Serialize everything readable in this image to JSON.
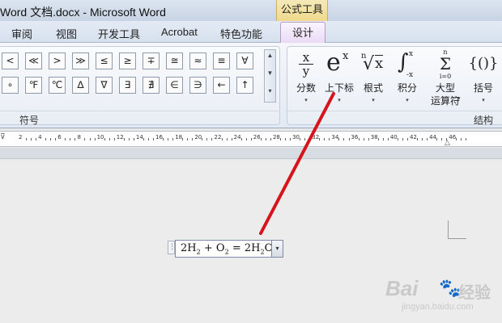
{
  "window": {
    "title": "Word 文档.docx - Microsoft Word",
    "context_tab_header": "公式工具"
  },
  "tabs": [
    "审阅",
    "视图",
    "开发工具",
    "Acrobat",
    "特色功能"
  ],
  "active_tab": "设计",
  "symbols": {
    "row1": [
      "<",
      "≪",
      ">",
      "≫",
      "≤",
      "≥",
      "∓",
      "≅",
      "≈",
      "≡",
      "∀"
    ],
    "row2": [
      "∘",
      "℉",
      "℃",
      "∆",
      "∇",
      "∃",
      "∄",
      "∈",
      "∋",
      "←",
      "↑"
    ],
    "group_label": "符号",
    "scroll_glyphs": [
      "▲",
      "▼",
      "▾"
    ]
  },
  "structures": {
    "group_label": "结构",
    "buttons": [
      {
        "label": "分数",
        "icon": "fraction-icon",
        "glyph_top": "x",
        "glyph_bottom": "y"
      },
      {
        "label": "上下标",
        "icon": "script-icon",
        "glyph_base": "e",
        "glyph_sup": "x"
      },
      {
        "label": "根式",
        "icon": "radical-icon",
        "glyph_index": "n",
        "glyph_radicand": "x"
      },
      {
        "label": "积分",
        "icon": "integral-icon",
        "glyph_upper": "x",
        "glyph_lower": "-x"
      },
      {
        "label": "大型",
        "label2": "运算符",
        "icon": "sum-icon",
        "glyph_upper": "n",
        "glyph_lower": "i=0"
      },
      {
        "label": "括号",
        "icon": "bracket-icon",
        "glyph": "{()}"
      }
    ],
    "dropdown_glyph": "▾"
  },
  "ruler": {
    "numbers": [
      "2",
      "4",
      "6",
      "8",
      "10",
      "12",
      "14",
      "16",
      "18",
      "20",
      "22",
      "24",
      "26",
      "28",
      "30",
      "32",
      "34",
      "36",
      "38",
      "40",
      "42",
      "44",
      "46"
    ]
  },
  "equation": {
    "coef": "2",
    "h": "H",
    "h_sub": "2",
    "plus": "+",
    "o": "O",
    "o_sub": "2",
    "equals": "=",
    "rhs_coef": "2",
    "rhs_h": "H",
    "rhs_h_sub": "2",
    "rhs_o": "O",
    "handle_glyph": "⋮",
    "dropdown_glyph": "▾"
  },
  "watermark": {
    "logo": "Bai",
    "paw": "🐾",
    "cn": "经验",
    "url": "jingyan.baidu.com"
  },
  "colors": {
    "annotation_arrow": "#d6141b",
    "context_tab": "#efd98c",
    "design_tab": "#e9d9f4"
  }
}
